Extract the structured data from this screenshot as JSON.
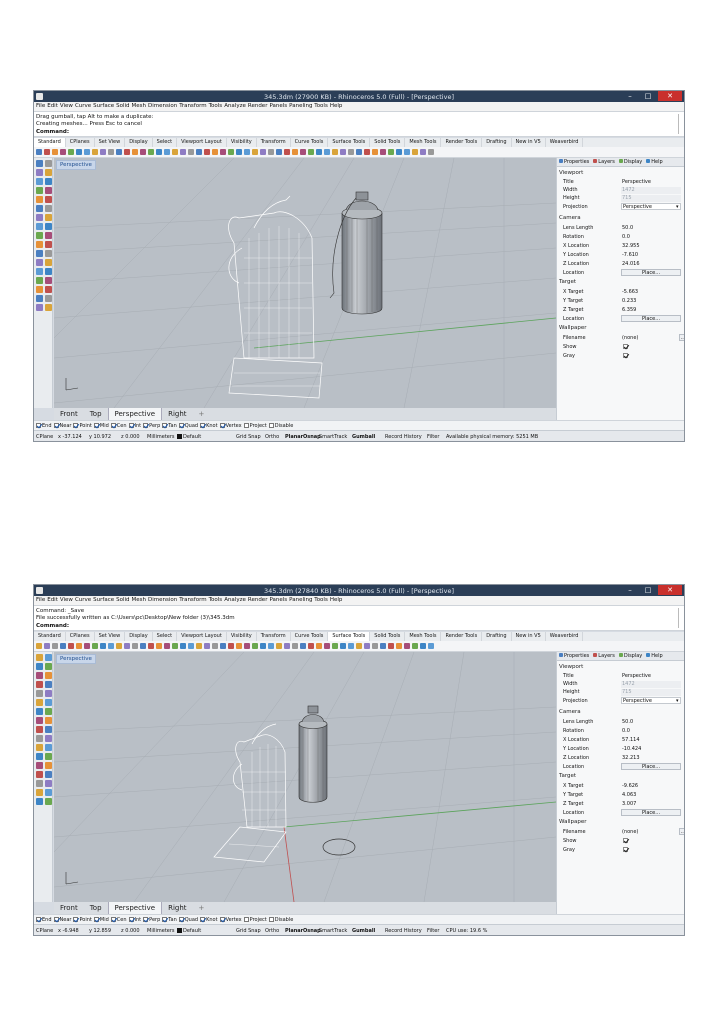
{
  "common": {
    "menu": [
      "File",
      "Edit",
      "View",
      "Curve",
      "Surface",
      "Solid",
      "Mesh",
      "Dimension",
      "Transform",
      "Tools",
      "Analyze",
      "Render",
      "Panels",
      "Paneling Tools",
      "Help"
    ],
    "tabs": [
      "Standard",
      "CPlanes",
      "Set View",
      "Display",
      "Select",
      "Viewport Layout",
      "Visibility",
      "Transform",
      "Curve Tools",
      "Surface Tools",
      "Solid Tools",
      "Mesh Tools",
      "Render Tools",
      "Drafting",
      "New in V5",
      "Weaverbird"
    ],
    "view_tabs": [
      "Front",
      "Top",
      "Perspective",
      "Right"
    ],
    "plus": "+",
    "viewport_label": "Perspective",
    "osnaps": [
      {
        "label": "End",
        "on": true
      },
      {
        "label": "Near",
        "on": true
      },
      {
        "label": "Point",
        "on": true
      },
      {
        "label": "Mid",
        "on": true
      },
      {
        "label": "Cen",
        "on": true
      },
      {
        "label": "Int",
        "on": true
      },
      {
        "label": "Perp",
        "on": true
      },
      {
        "label": "Tan",
        "on": true
      },
      {
        "label": "Quad",
        "on": true
      },
      {
        "label": "Knot",
        "on": true
      },
      {
        "label": "Vertex",
        "on": true
      },
      {
        "label": "Project",
        "on": false
      },
      {
        "label": "Disable",
        "on": false
      }
    ],
    "status": {
      "cplane": "CPlane",
      "z": "z 0.000",
      "units": "Millimeters",
      "layer": "Default",
      "items": [
        "Grid Snap",
        "Ortho",
        "Planar",
        "Osnap",
        "SmartTrack",
        "Gumball",
        "Record History",
        "Filter"
      ]
    },
    "panel": {
      "tabs": [
        "Properties",
        "Layers",
        "Display",
        "Help"
      ],
      "viewport": "Viewport",
      "title_label": "Title",
      "title_value": "Perspective",
      "width_label": "Width",
      "width_value": "1472",
      "height_label": "Height",
      "height_value": "715",
      "projection_label": "Projection",
      "projection_value": "Perspective",
      "camera": "Camera",
      "lens_label": "Lens Length",
      "lens_value": "50.0",
      "rotation_label": "Rotation",
      "rotation_value": "0.0",
      "xloc_label": "X Location",
      "yloc_label": "Y Location",
      "zloc_label": "Z Location",
      "location_label": "Location",
      "place": "Place...",
      "target": "Target",
      "xt_label": "X Target",
      "yt_label": "Y Target",
      "zt_label": "Z Target",
      "wallpaper": "Wallpaper",
      "filename_label": "Filename",
      "filename_value": "(none)",
      "dots": "...",
      "show_label": "Show",
      "gray_label": "Gray"
    },
    "colors": {
      "titlebar": "#2b3e57",
      "close": "#c9302c",
      "viewport": "#b9bfc6",
      "accent": "#1f4e8f"
    }
  },
  "shots": [
    {
      "window_title": "345.3dm (27900 KB) - Rhinoceros 5.0 (Full) - [Perspective]",
      "cmd_lines": [
        "Drag gumball, tap Alt to make a duplicate:",
        "Creating meshes... Press Esc to cancel"
      ],
      "prompt": "Command:",
      "active_tab": "Standard",
      "x": "x -37.124",
      "y": "y 10.972",
      "memory": "Available physical memory: 5251 MB",
      "camera": {
        "x": "32.955",
        "y": "-7.610",
        "z": "24.016"
      },
      "target": {
        "x": "-5.663",
        "y": "0.233",
        "z": "6.359"
      }
    },
    {
      "window_title": "345.3dm (27840 KB) - Rhinoceros 5.0 (Full) - [Perspective]",
      "cmd_lines": [
        "Command: _Save",
        "File successfully written as C:\\Users\\pc\\Desktop\\New folder (3)\\345.3dm"
      ],
      "prompt": "Command:",
      "active_tab": "Surface Tools",
      "x": "x -6.948",
      "y": "y 12.859",
      "memory": "CPU use: 19.6 %",
      "camera": {
        "x": "57.114",
        "y": "-10.424",
        "z": "32.213"
      },
      "target": {
        "x": "-9.626",
        "y": "4.063",
        "z": "3.007"
      }
    }
  ]
}
